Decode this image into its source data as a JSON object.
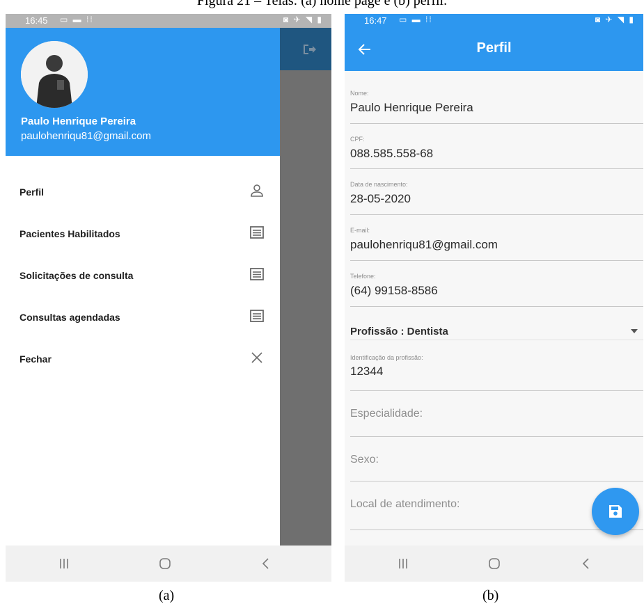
{
  "figure_title": "Figura 21 – Telas: (a) home page e (b) perfil.",
  "captions": {
    "a": "(a)",
    "b": "(b)"
  },
  "screen_a": {
    "status_time": "16:45",
    "user_name": "Paulo Henrique Pereira",
    "user_email": "paulohenriqu81@gmail.com",
    "menu": [
      {
        "label": "Perfil",
        "icon": "person-outline-icon"
      },
      {
        "label": "Pacientes Habilitados",
        "icon": "list-icon"
      },
      {
        "label": "Solicitações de consulta",
        "icon": "list-icon"
      },
      {
        "label": "Consultas agendadas",
        "icon": "list-icon"
      },
      {
        "label": "Fechar",
        "icon": "close-icon"
      }
    ]
  },
  "screen_b": {
    "status_time": "16:47",
    "title": "Perfil",
    "fields": [
      {
        "label": "Nome:",
        "value": "Paulo Henrique Pereira"
      },
      {
        "label": "CPF:",
        "value": "088.585.558-68"
      },
      {
        "label": "Data de nascimento:",
        "value": "28-05-2020"
      },
      {
        "label": "E-mail:",
        "value": "paulohenriqu81@gmail.com"
      },
      {
        "label": "Telefone:",
        "value": "(64) 99158-8586"
      }
    ],
    "profession_dropdown": "Profissão : Dentista",
    "profession_id": {
      "label": "Identificação da profissão:",
      "value": "12344"
    },
    "placeholders": [
      "Especialidade:",
      "Sexo:",
      "Local de atendimento:"
    ]
  },
  "colors": {
    "primary": "#2d97ef",
    "scrim": "#6f6f6f",
    "appbar_dim": "#1f5680",
    "fab": "#2f98f0"
  }
}
